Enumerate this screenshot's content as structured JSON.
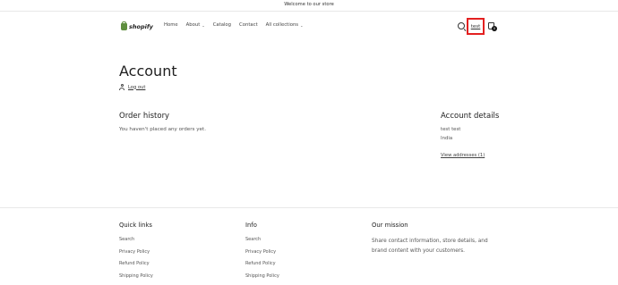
{
  "announcement": "Welcome to our store",
  "logo": {
    "text": "shopify"
  },
  "nav": [
    {
      "label": "Home",
      "has_dropdown": false
    },
    {
      "label": "About",
      "has_dropdown": true
    },
    {
      "label": "Catalog",
      "has_dropdown": false
    },
    {
      "label": "Contact",
      "has_dropdown": false
    },
    {
      "label": "All collections",
      "has_dropdown": true
    }
  ],
  "header_icons": {
    "search": "search-icon",
    "account_label": "test",
    "cart": "cart-icon",
    "cart_count": "0"
  },
  "highlight_color": "#e32020",
  "page": {
    "title": "Account",
    "logout_label": "Log out"
  },
  "order_history": {
    "heading": "Order history",
    "empty_text": "You haven't placed any orders yet."
  },
  "account_details": {
    "heading": "Account details",
    "name": "test test",
    "country": "India",
    "view_addresses_label": "View addresses (1)"
  },
  "footer": {
    "quick_links": {
      "heading": "Quick links",
      "links": [
        "Search",
        "Privacy Policy",
        "Refund Policy",
        "Shipping Policy"
      ]
    },
    "info": {
      "heading": "Info",
      "links": [
        "Search",
        "Privacy Policy",
        "Refund Policy",
        "Shipping Policy"
      ]
    },
    "mission": {
      "heading": "Our mission",
      "text": "Share contact information, store details, and brand content with your customers."
    }
  }
}
